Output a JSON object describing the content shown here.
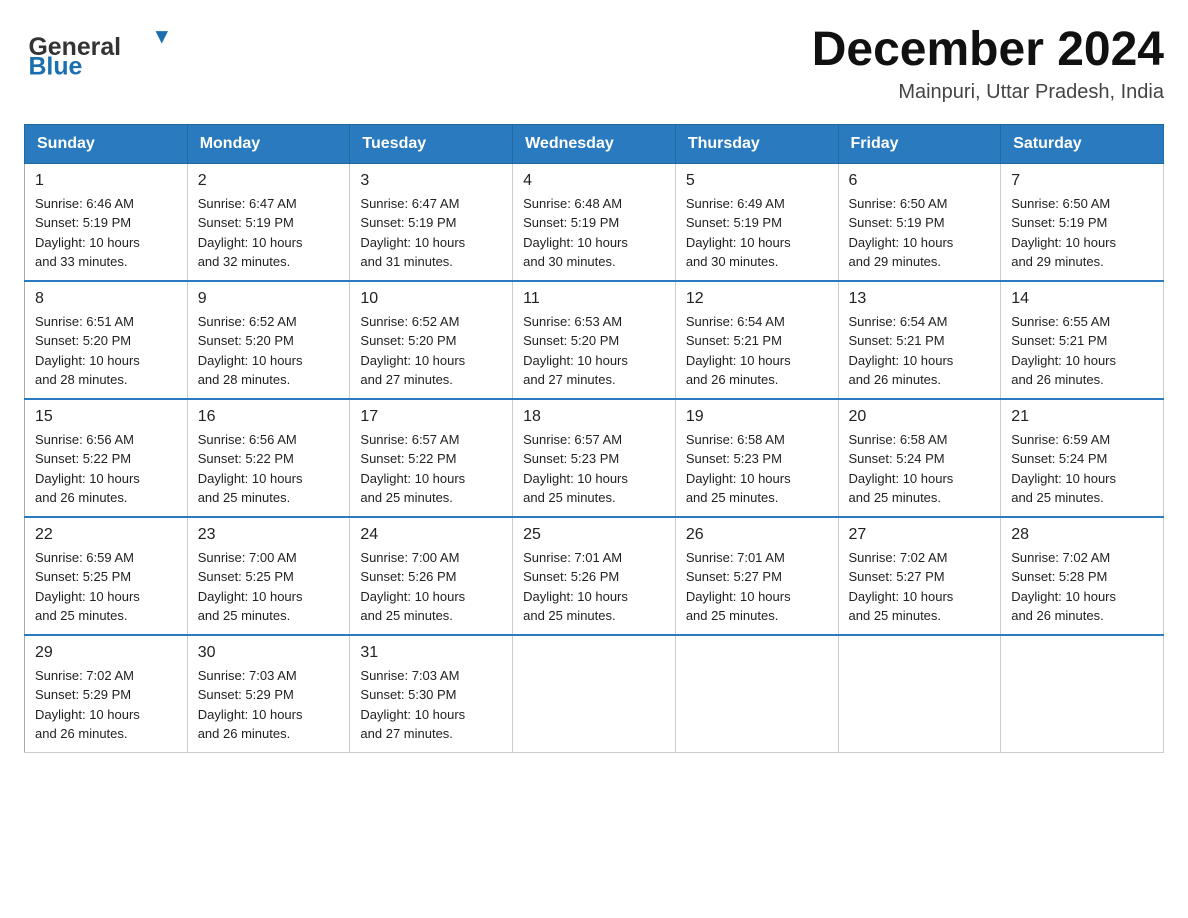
{
  "header": {
    "logo_general": "General",
    "logo_blue": "Blue",
    "month_year": "December 2024",
    "location": "Mainpuri, Uttar Pradesh, India"
  },
  "days_of_week": [
    "Sunday",
    "Monday",
    "Tuesday",
    "Wednesday",
    "Thursday",
    "Friday",
    "Saturday"
  ],
  "weeks": [
    [
      {
        "day": "1",
        "sunrise": "6:46 AM",
        "sunset": "5:19 PM",
        "daylight": "10 hours and 33 minutes."
      },
      {
        "day": "2",
        "sunrise": "6:47 AM",
        "sunset": "5:19 PM",
        "daylight": "10 hours and 32 minutes."
      },
      {
        "day": "3",
        "sunrise": "6:47 AM",
        "sunset": "5:19 PM",
        "daylight": "10 hours and 31 minutes."
      },
      {
        "day": "4",
        "sunrise": "6:48 AM",
        "sunset": "5:19 PM",
        "daylight": "10 hours and 30 minutes."
      },
      {
        "day": "5",
        "sunrise": "6:49 AM",
        "sunset": "5:19 PM",
        "daylight": "10 hours and 30 minutes."
      },
      {
        "day": "6",
        "sunrise": "6:50 AM",
        "sunset": "5:19 PM",
        "daylight": "10 hours and 29 minutes."
      },
      {
        "day": "7",
        "sunrise": "6:50 AM",
        "sunset": "5:19 PM",
        "daylight": "10 hours and 29 minutes."
      }
    ],
    [
      {
        "day": "8",
        "sunrise": "6:51 AM",
        "sunset": "5:20 PM",
        "daylight": "10 hours and 28 minutes."
      },
      {
        "day": "9",
        "sunrise": "6:52 AM",
        "sunset": "5:20 PM",
        "daylight": "10 hours and 28 minutes."
      },
      {
        "day": "10",
        "sunrise": "6:52 AM",
        "sunset": "5:20 PM",
        "daylight": "10 hours and 27 minutes."
      },
      {
        "day": "11",
        "sunrise": "6:53 AM",
        "sunset": "5:20 PM",
        "daylight": "10 hours and 27 minutes."
      },
      {
        "day": "12",
        "sunrise": "6:54 AM",
        "sunset": "5:21 PM",
        "daylight": "10 hours and 26 minutes."
      },
      {
        "day": "13",
        "sunrise": "6:54 AM",
        "sunset": "5:21 PM",
        "daylight": "10 hours and 26 minutes."
      },
      {
        "day": "14",
        "sunrise": "6:55 AM",
        "sunset": "5:21 PM",
        "daylight": "10 hours and 26 minutes."
      }
    ],
    [
      {
        "day": "15",
        "sunrise": "6:56 AM",
        "sunset": "5:22 PM",
        "daylight": "10 hours and 26 minutes."
      },
      {
        "day": "16",
        "sunrise": "6:56 AM",
        "sunset": "5:22 PM",
        "daylight": "10 hours and 25 minutes."
      },
      {
        "day": "17",
        "sunrise": "6:57 AM",
        "sunset": "5:22 PM",
        "daylight": "10 hours and 25 minutes."
      },
      {
        "day": "18",
        "sunrise": "6:57 AM",
        "sunset": "5:23 PM",
        "daylight": "10 hours and 25 minutes."
      },
      {
        "day": "19",
        "sunrise": "6:58 AM",
        "sunset": "5:23 PM",
        "daylight": "10 hours and 25 minutes."
      },
      {
        "day": "20",
        "sunrise": "6:58 AM",
        "sunset": "5:24 PM",
        "daylight": "10 hours and 25 minutes."
      },
      {
        "day": "21",
        "sunrise": "6:59 AM",
        "sunset": "5:24 PM",
        "daylight": "10 hours and 25 minutes."
      }
    ],
    [
      {
        "day": "22",
        "sunrise": "6:59 AM",
        "sunset": "5:25 PM",
        "daylight": "10 hours and 25 minutes."
      },
      {
        "day": "23",
        "sunrise": "7:00 AM",
        "sunset": "5:25 PM",
        "daylight": "10 hours and 25 minutes."
      },
      {
        "day": "24",
        "sunrise": "7:00 AM",
        "sunset": "5:26 PM",
        "daylight": "10 hours and 25 minutes."
      },
      {
        "day": "25",
        "sunrise": "7:01 AM",
        "sunset": "5:26 PM",
        "daylight": "10 hours and 25 minutes."
      },
      {
        "day": "26",
        "sunrise": "7:01 AM",
        "sunset": "5:27 PM",
        "daylight": "10 hours and 25 minutes."
      },
      {
        "day": "27",
        "sunrise": "7:02 AM",
        "sunset": "5:27 PM",
        "daylight": "10 hours and 25 minutes."
      },
      {
        "day": "28",
        "sunrise": "7:02 AM",
        "sunset": "5:28 PM",
        "daylight": "10 hours and 26 minutes."
      }
    ],
    [
      {
        "day": "29",
        "sunrise": "7:02 AM",
        "sunset": "5:29 PM",
        "daylight": "10 hours and 26 minutes."
      },
      {
        "day": "30",
        "sunrise": "7:03 AM",
        "sunset": "5:29 PM",
        "daylight": "10 hours and 26 minutes."
      },
      {
        "day": "31",
        "sunrise": "7:03 AM",
        "sunset": "5:30 PM",
        "daylight": "10 hours and 27 minutes."
      },
      null,
      null,
      null,
      null
    ]
  ],
  "labels": {
    "sunrise": "Sunrise:",
    "sunset": "Sunset:",
    "daylight": "Daylight:"
  }
}
